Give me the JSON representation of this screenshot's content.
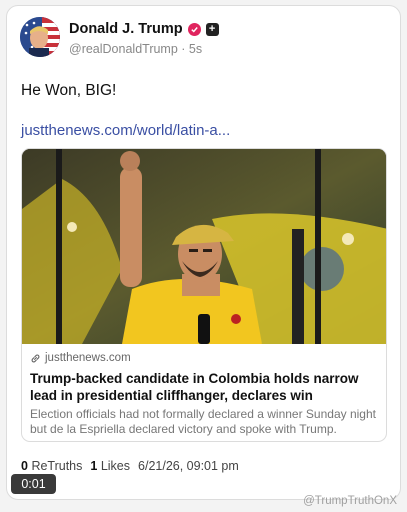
{
  "author": {
    "name": "Donald J. Trump",
    "handle": "@realDonaldTrump",
    "time": "5s"
  },
  "post": {
    "text": "He Won, BIG!",
    "link": "justthenews.com/world/latin-a..."
  },
  "preview": {
    "domain": "justthenews.com",
    "title": "Trump-backed candidate in Colombia holds narrow lead in presidential cliffhanger, declares win",
    "description": "Election officials had not formally declared a winner Sunday night but de la Espriella declared victory and spoke with Trump."
  },
  "stats": {
    "retruths_count": "0",
    "retruths_label": "ReTruths",
    "likes_count": "1",
    "likes_label": "Likes",
    "timestamp": "6/21/26, 09:01 pm"
  },
  "video": {
    "duration": "0:01"
  },
  "watermark": "@TrumpTruthOnX",
  "colors": {
    "link": "#3a4fa3",
    "verified": "#e0245e",
    "shirt": "#f2c61f"
  },
  "icons": [
    "verified-badge-icon",
    "plus-badge-icon",
    "link-icon"
  ]
}
